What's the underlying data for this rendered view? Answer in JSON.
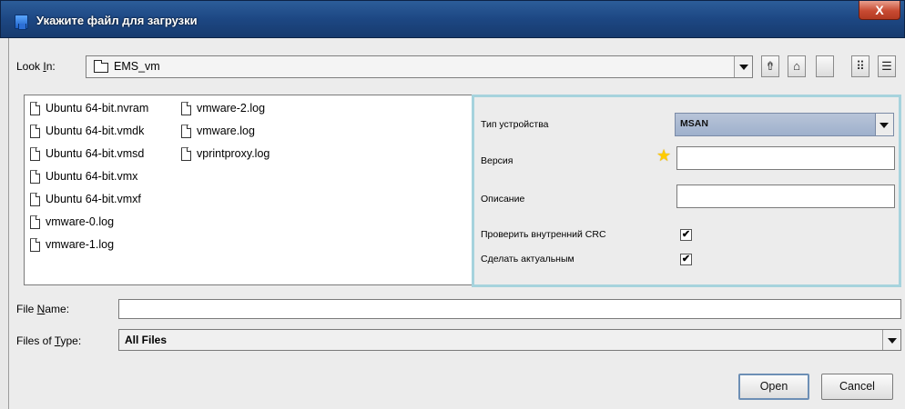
{
  "window": {
    "title": "Укажите файл для загрузки",
    "close_glyph": "X"
  },
  "look_in": {
    "label_prefix": "Look ",
    "label_mnemonic": "I",
    "label_suffix": "n:",
    "value": "EMS_vm"
  },
  "toolbar": {
    "up_glyph": "⇮",
    "home_glyph": "⌂",
    "newfolder_glyph": "",
    "list_glyph": "⠿",
    "details_glyph": "☰"
  },
  "files": [
    "Ubuntu 64-bit.nvram",
    "Ubuntu 64-bit.vmdk",
    "Ubuntu 64-bit.vmsd",
    "Ubuntu 64-bit.vmx",
    "Ubuntu 64-bit.vmxf",
    "vmware-0.log",
    "vmware-1.log",
    "vmware-2.log",
    "vmware.log",
    "vprintproxy.log"
  ],
  "accessory": {
    "device_type_label": "Тип устройства",
    "device_type_value": "MSAN",
    "version_label": "Версия",
    "version_value": "",
    "description_label": "Описание",
    "description_value": "",
    "check_crc_label": "Проверить внутренний CRC",
    "check_crc_checked": true,
    "make_current_label": "Сделать актуальным",
    "make_current_checked": true,
    "check_glyph": "✔"
  },
  "file_name": {
    "label_prefix": "File ",
    "label_mnemonic": "N",
    "label_suffix": "ame:",
    "value": ""
  },
  "files_of_type": {
    "label_prefix": "Files of ",
    "label_mnemonic": "T",
    "label_suffix": "ype:",
    "value": "All Files"
  },
  "buttons": {
    "open": "Open",
    "cancel": "Cancel"
  },
  "colors": {
    "titlebar": "#1d4783",
    "accessory_border": "#a6d3dd",
    "combo_selected": "#9eb0cc"
  }
}
